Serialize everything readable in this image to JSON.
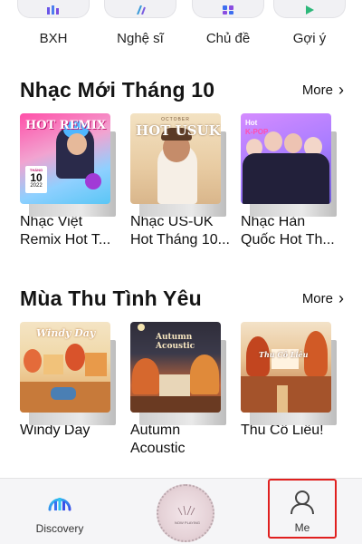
{
  "categories": [
    {
      "label": "BXH",
      "icon": "chart-bars-icon"
    },
    {
      "label": "Nghệ sĩ",
      "icon": "artist-icon"
    },
    {
      "label": "Chủ đề",
      "icon": "topic-grid-icon"
    },
    {
      "label": "Gợi ý",
      "icon": "suggest-icon"
    }
  ],
  "sections": [
    {
      "title": "Nhạc Mới Tháng 10",
      "more": "More",
      "cards": [
        {
          "title_line1": "Nhạc Việt",
          "title_line2": "Remix Hot T...",
          "cover_text": "HOT REMIX",
          "cover_sub": "10",
          "cover_year": "2022",
          "cover_label": "THÁNG"
        },
        {
          "title_line1": "Nhạc US-UK",
          "title_line2": "Hot Tháng 10...",
          "cover_text": "HOT USUK",
          "cover_sub": "OCTOBER"
        },
        {
          "title_line1": "Nhạc Hàn",
          "title_line2": "Quốc Hot Th...",
          "cover_text": "Hot",
          "cover_sub": "K-POP"
        }
      ]
    },
    {
      "title": "Mùa Thu Tình Yêu",
      "more": "More",
      "cards": [
        {
          "title_line1": "Windy Day",
          "title_line2": "",
          "cover_text": "Windy Day"
        },
        {
          "title_line1": "Autumn",
          "title_line2": "Acoustic",
          "cover_text": "Autumn Acoustic"
        },
        {
          "title_line1": "Thu Cô Liêu!",
          "title_line2": "",
          "cover_text": "Thu Cô Liêu"
        }
      ]
    }
  ],
  "nav": {
    "discovery_label": "Discovery",
    "me_label": "Me",
    "player_caption": "NOW PLAYING"
  },
  "colors": {
    "accent_discovery": "#3a6df0",
    "highlight": "#e0201f"
  }
}
